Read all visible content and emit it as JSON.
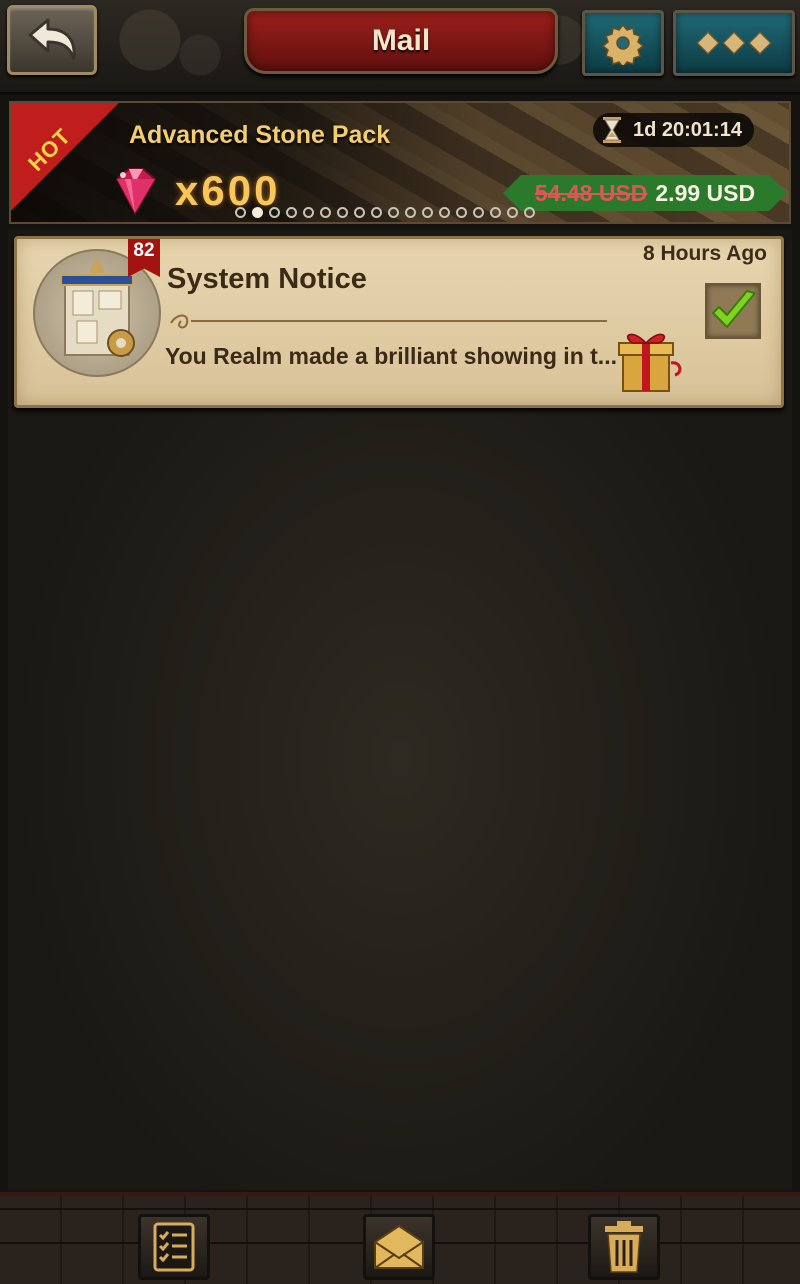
{
  "header": {
    "title": "Mail",
    "icons": {
      "back": "back-arrow-icon",
      "settings": "gear-icon",
      "more": "more-diamonds-icon"
    }
  },
  "banner": {
    "hot_label": "HOT",
    "pack_name": "Advanced Stone Pack",
    "quantity": "x600",
    "timer": "1d 20:01:14",
    "old_price": "54.48 USD",
    "new_price": "2.99 USD",
    "carousel": {
      "total": 18,
      "active_index": 1
    },
    "icons": {
      "gem": "ruby-gem-icon",
      "timer": "hourglass-icon"
    }
  },
  "mails": [
    {
      "sender": "System Notice",
      "time": "8 Hours Ago",
      "preview": "You Realm made a brilliant showing in t...",
      "badge_count": "82",
      "has_attachment": true,
      "checked": true,
      "icons": {
        "avatar": "notice-board-icon",
        "attachment": "gift-box-icon",
        "check": "checkmark-icon"
      }
    }
  ],
  "toolbar": {
    "icons": {
      "list": "checklist-icon",
      "read": "open-envelope-icon",
      "delete": "trash-icon"
    }
  },
  "colors": {
    "accent_red": "#9b1f1b",
    "teal": "#1f6a75",
    "gold": "#f4ce6c",
    "parchment": "#e8d6b0",
    "price_green": "#2b7a2c"
  }
}
